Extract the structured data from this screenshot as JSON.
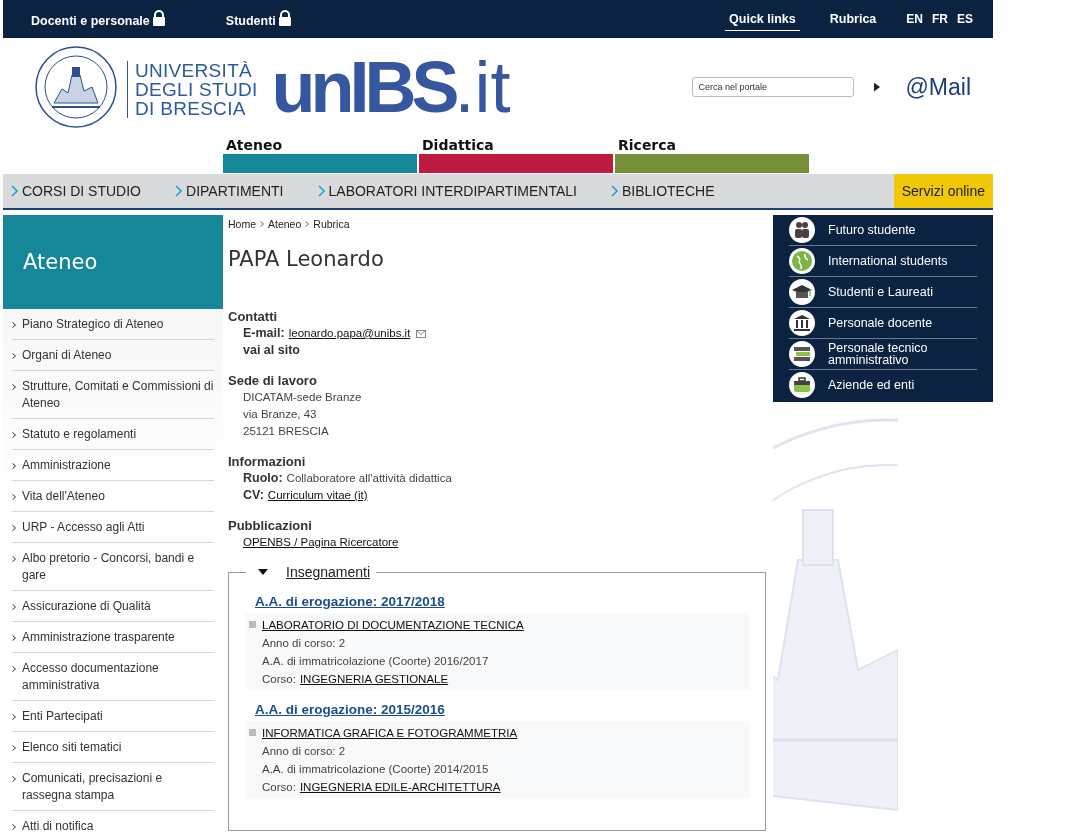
{
  "top_bar": {
    "left_links": [
      {
        "label": "Docenti e personale"
      },
      {
        "label": "Studenti"
      }
    ],
    "right_links": [
      {
        "label": "Quick links",
        "selected": true
      },
      {
        "label": "Rubrica",
        "selected": false
      }
    ],
    "languages": [
      "EN",
      "FR",
      "ES"
    ]
  },
  "header": {
    "university_lines": [
      "UNIVERSITÀ",
      "DEGLI STUDI",
      "DI BRESCIA"
    ],
    "logo_main": "unIBS",
    "logo_suffix": ".it",
    "search": {
      "placeholder": "Cerca nel portale"
    },
    "mail_link": "@Mail"
  },
  "sections": [
    {
      "label": "Ateneo",
      "color": "#168798"
    },
    {
      "label": "Didattica",
      "color": "#be1a42"
    },
    {
      "label": "Ricerca",
      "color": "#76903a"
    }
  ],
  "nav": {
    "items": [
      "CORSI DI STUDIO",
      "DIPARTIMENTI",
      "LABORATORI INTERDIPARTIMENTALI",
      "BIBLIOTECHE"
    ],
    "services": "Servizi online"
  },
  "sidebar": {
    "title": "Ateneo",
    "items": [
      "Piano Strategico di Ateneo",
      "Organi di Ateneo",
      "Strutture, Comitati e Commissioni di Ateneo",
      "Statuto e regolamenti",
      "Amministrazione",
      "Vita dell'Ateneo",
      "URP - Accesso agli Atti",
      "Albo pretorio - Concorsi, bandi e gare",
      "Assicurazione di Qualità",
      "Amministrazione trasparente",
      "Accesso documentazione amministrativa",
      "Enti Partecipati",
      "Elenco siti tematici",
      "Comunicati, precisazioni e rassegna stampa",
      "Atti di notifica"
    ]
  },
  "breadcrumb": [
    "Home",
    "Ateneo",
    "Rubrica"
  ],
  "person": {
    "name": "PAPA Leonardo",
    "contacts": {
      "heading": "Contatti",
      "email_label": "E-mail:",
      "email": "leonardo.papa@unibs.it",
      "site_link": "vai al sito"
    },
    "workplace": {
      "heading": "Sede di lavoro",
      "lines": [
        "DICATAM-sede Branze",
        "via Branze, 43",
        "25121 BRESCIA"
      ]
    },
    "info": {
      "heading": "Informazioni",
      "fields": [
        {
          "label": "Ruolo:",
          "value": "Collaboratore all'attività didattica",
          "kind": "text"
        },
        {
          "label": "CV:",
          "value": "Curriculum vitae (it)",
          "kind": "link"
        }
      ]
    },
    "publications": {
      "heading": "Pubblicazioni",
      "link": "OPENBS / Pagina Ricercatore"
    }
  },
  "teaching": {
    "legend": "Insegnamenti",
    "expanded": true,
    "years": [
      {
        "title": "A.A. di erogazione: 2017/2018",
        "courses": [
          {
            "name": "LABORATORIO DI DOCUMENTAZIONE TECNICA",
            "year": "Anno di corso: 2",
            "cohort": "A.A. di immatricolazione (Coorte) 2016/2017",
            "course_label": "Corso:",
            "course": "INGEGNERIA GESTIONALE"
          }
        ]
      },
      {
        "title": "A.A. di erogazione: 2015/2016",
        "courses": [
          {
            "name": "INFORMATICA GRAFICA E FOTOGRAMMETRIA",
            "year": "Anno di corso: 2",
            "cohort": "A.A. di immatricolazione (Coorte) 2014/2015",
            "course_label": "Corso:",
            "course": "INGEGNERIA EDILE-ARCHITETTURA"
          }
        ]
      }
    ]
  },
  "quick_links": [
    "Futuro studente",
    "International students",
    "Studenti e Laureati",
    "Personale docente",
    "Personale tecnico amministrativo",
    "Aziende ed enti"
  ]
}
